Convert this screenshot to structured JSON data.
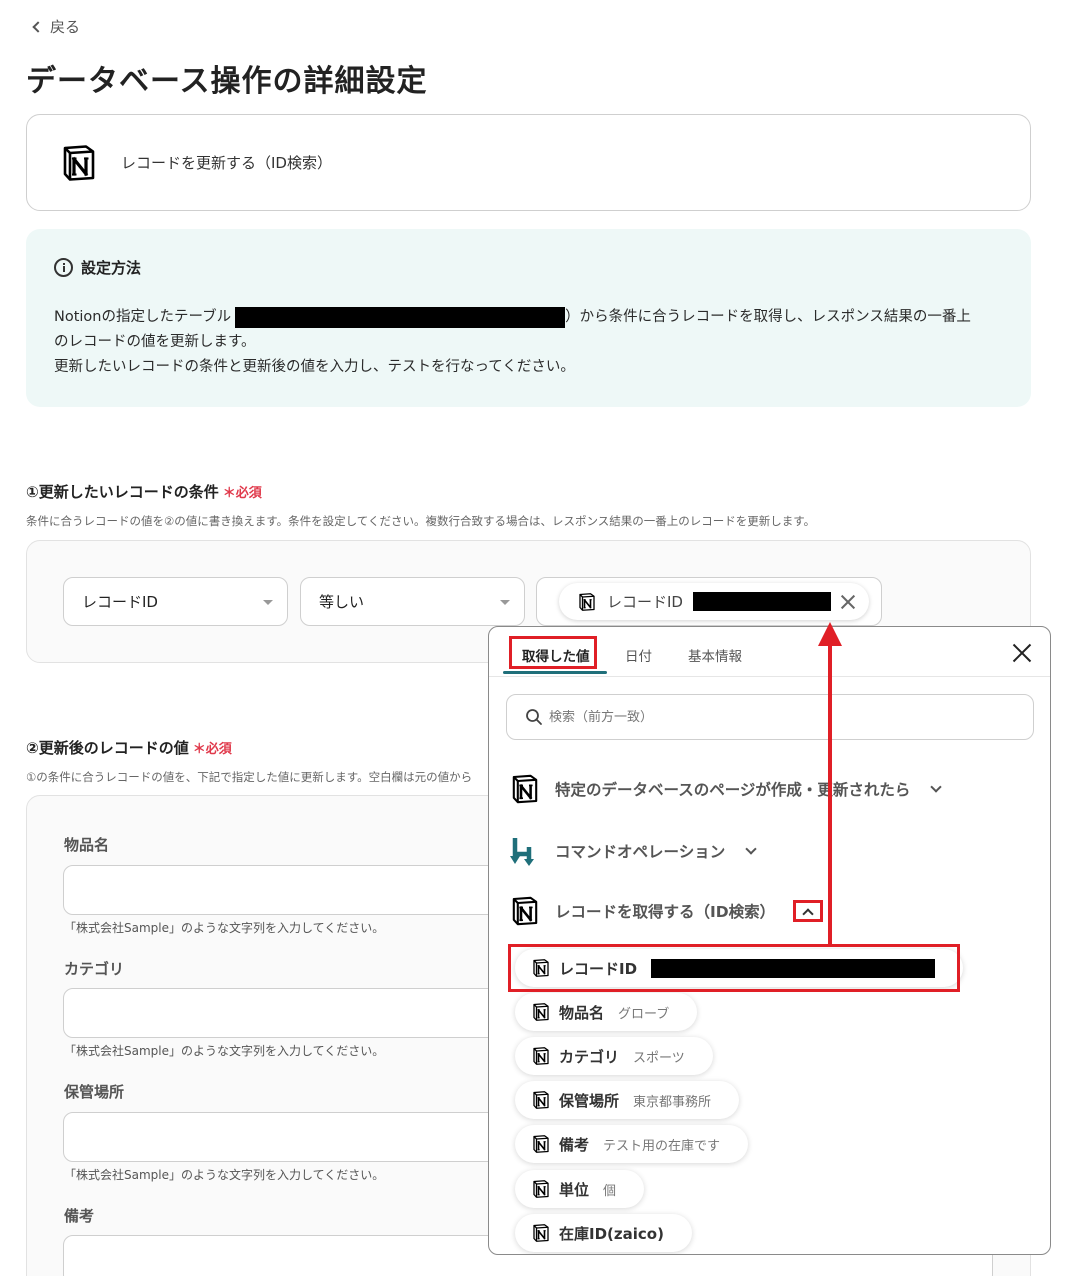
{
  "header": {
    "back_label": "戻る",
    "page_title": "データベース操作の詳細設定"
  },
  "action": {
    "icon": "notion-icon",
    "label": "レコードを更新する（ID検索）"
  },
  "info": {
    "title": "設定方法",
    "line1_prefix": "Notionの指定したテーブル",
    "line1_suffix": "）から条件に合うレコードを取得し、レスポンス結果の一番上",
    "line2": "のレコードの値を更新します。",
    "line3": "更新したいレコードの条件と更新後の値を入力し、テストを行なってください。"
  },
  "condition_section": {
    "title": "①更新したいレコードの条件",
    "required": "＊必須",
    "description": "条件に合うレコードの値を②の値に書き換えます。条件を設定してください。複数行合致する場合は、レスポンス結果の一番上のレコードを更新します。",
    "field_select": "レコードID",
    "operator_select": "等しい",
    "value_chip_label": "レコードID"
  },
  "update_section": {
    "title": "②更新後のレコードの値",
    "required": "＊必須",
    "description": "①の条件に合うレコードの値を、下記で指定した値に更新します。空白欄は元の値から",
    "fields": [
      {
        "label": "物品名",
        "help": "「株式会社Sample」のような文字列を入力してください。"
      },
      {
        "label": "カテゴリ",
        "help": "「株式会社Sample」のような文字列を入力してください。"
      },
      {
        "label": "保管場所",
        "help": "「株式会社Sample」のような文字列を入力してください。"
      },
      {
        "label": "備考",
        "help": ""
      }
    ]
  },
  "popup": {
    "tabs": [
      "取得した値",
      "日付",
      "基本情報"
    ],
    "search_placeholder": "検索（前方一致）",
    "groups": [
      {
        "label": "特定のデータベースのページが作成・更新されたら",
        "icon": "notion-icon"
      },
      {
        "label": "コマンドオペレーション",
        "icon": "yoom-command-icon"
      },
      {
        "label": "レコードを取得する（ID検索）",
        "icon": "notion-icon"
      }
    ],
    "items": [
      {
        "label": "レコードID",
        "value": ""
      },
      {
        "label": "物品名",
        "value": "グローブ"
      },
      {
        "label": "カテゴリ",
        "value": "スポーツ"
      },
      {
        "label": "保管場所",
        "value": "東京都事務所"
      },
      {
        "label": "備考",
        "value": "テスト用の在庫です"
      },
      {
        "label": "単位",
        "value": "個"
      },
      {
        "label": "在庫ID(zaico)",
        "value": ""
      }
    ]
  },
  "colors": {
    "accent_teal": "#1f6f7a",
    "highlight_red": "#e01f26",
    "required_red": "#e0394b",
    "info_bg": "#eef8f7"
  }
}
